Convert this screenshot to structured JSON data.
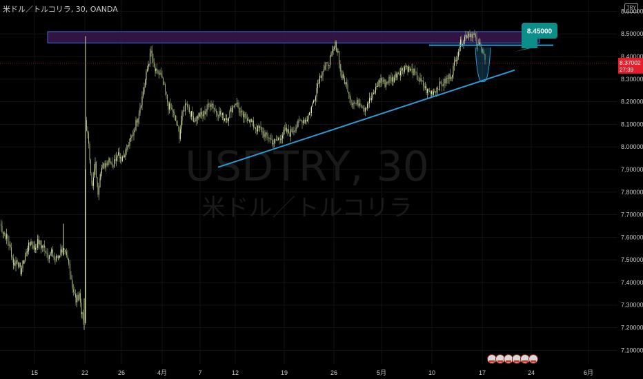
{
  "header": {
    "title": "米ドル／トルコリラ, 30, OANDA"
  },
  "currency_badge": "TRY",
  "watermark": {
    "symbol": "USDTRY, 30",
    "name": "米ドル／トルコリラ"
  },
  "colors": {
    "background": "#000000",
    "up_candle": "#d8e6a8",
    "down_candle": "#a3b878",
    "trendline": "#2a9bd6",
    "zone_fill": "#3a1650",
    "zone_border": "#3a6fd8",
    "current_price_bg": "#e21f2a",
    "callout_bg": "#0c8e8a"
  },
  "current_price": {
    "value": "8.37002",
    "countdown": "27:39"
  },
  "callout": {
    "text": "8.45000"
  },
  "chart_data": {
    "type": "candlestick",
    "title": "",
    "y_ticks": [
      "8.60000",
      "8.50000",
      "8.40000",
      "8.30000",
      "8.20000",
      "8.10000",
      "8.00000",
      "7.90000",
      "7.80000",
      "7.70000",
      "7.60000",
      "7.50000",
      "7.40000",
      "7.30000",
      "7.20000",
      "7.10000"
    ],
    "ylim": [
      7.04,
      8.65
    ],
    "x_ticks": [
      "15",
      "22",
      "26",
      "4月",
      "7",
      "12",
      "19",
      "26",
      "5月",
      "10",
      "17",
      "24",
      "6月"
    ],
    "series": [
      {
        "x": 0,
        "y": 7.66
      },
      {
        "x": 5,
        "y": 7.62
      },
      {
        "x": 10,
        "y": 7.6
      },
      {
        "x": 15,
        "y": 7.55
      },
      {
        "x": 20,
        "y": 7.48
      },
      {
        "x": 25,
        "y": 7.5
      },
      {
        "x": 30,
        "y": 7.45
      },
      {
        "x": 35,
        "y": 7.5
      },
      {
        "x": 40,
        "y": 7.55
      },
      {
        "x": 45,
        "y": 7.58
      },
      {
        "x": 50,
        "y": 7.55
      },
      {
        "x": 55,
        "y": 7.58
      },
      {
        "x": 60,
        "y": 7.56
      },
      {
        "x": 65,
        "y": 7.55
      },
      {
        "x": 70,
        "y": 7.52
      },
      {
        "x": 75,
        "y": 7.53
      },
      {
        "x": 80,
        "y": 7.5
      },
      {
        "x": 85,
        "y": 7.52
      },
      {
        "x": 90,
        "y": 7.55
      },
      {
        "x": 95,
        "y": 7.52
      },
      {
        "x": 100,
        "y": 7.48
      },
      {
        "x": 105,
        "y": 7.38
      },
      {
        "x": 110,
        "y": 7.32
      },
      {
        "x": 115,
        "y": 7.35
      },
      {
        "x": 119,
        "y": 7.25
      },
      {
        "x": 122,
        "y": 7.22
      },
      {
        "x": 124,
        "y": 8.12
      },
      {
        "x": 127,
        "y": 8.05
      },
      {
        "x": 130,
        "y": 7.95
      },
      {
        "x": 134,
        "y": 7.82
      },
      {
        "x": 138,
        "y": 7.92
      },
      {
        "x": 142,
        "y": 7.8
      },
      {
        "x": 146,
        "y": 7.9
      },
      {
        "x": 152,
        "y": 7.92
      },
      {
        "x": 158,
        "y": 7.95
      },
      {
        "x": 164,
        "y": 7.92
      },
      {
        "x": 170,
        "y": 7.98
      },
      {
        "x": 176,
        "y": 7.95
      },
      {
        "x": 182,
        "y": 7.98
      },
      {
        "x": 188,
        "y": 8.02
      },
      {
        "x": 194,
        "y": 8.07
      },
      {
        "x": 200,
        "y": 8.14
      },
      {
        "x": 206,
        "y": 8.22
      },
      {
        "x": 212,
        "y": 8.32
      },
      {
        "x": 216,
        "y": 8.38
      },
      {
        "x": 219,
        "y": 8.42
      },
      {
        "x": 222,
        "y": 8.36
      },
      {
        "x": 226,
        "y": 8.33
      },
      {
        "x": 232,
        "y": 8.32
      },
      {
        "x": 238,
        "y": 8.26
      },
      {
        "x": 244,
        "y": 8.18
      },
      {
        "x": 250,
        "y": 8.16
      },
      {
        "x": 256,
        "y": 8.1
      },
      {
        "x": 260,
        "y": 8.05
      },
      {
        "x": 264,
        "y": 8.14
      },
      {
        "x": 270,
        "y": 8.2
      },
      {
        "x": 276,
        "y": 8.15
      },
      {
        "x": 282,
        "y": 8.12
      },
      {
        "x": 288,
        "y": 8.14
      },
      {
        "x": 294,
        "y": 8.14
      },
      {
        "x": 300,
        "y": 8.17
      },
      {
        "x": 306,
        "y": 8.2
      },
      {
        "x": 312,
        "y": 8.16
      },
      {
        "x": 318,
        "y": 8.15
      },
      {
        "x": 324,
        "y": 8.13
      },
      {
        "x": 330,
        "y": 8.13
      },
      {
        "x": 336,
        "y": 8.17
      },
      {
        "x": 342,
        "y": 8.2
      },
      {
        "x": 348,
        "y": 8.15
      },
      {
        "x": 354,
        "y": 8.13
      },
      {
        "x": 360,
        "y": 8.13
      },
      {
        "x": 366,
        "y": 8.1
      },
      {
        "x": 372,
        "y": 8.08
      },
      {
        "x": 378,
        "y": 8.08
      },
      {
        "x": 384,
        "y": 8.05
      },
      {
        "x": 390,
        "y": 8.04
      },
      {
        "x": 396,
        "y": 8.02
      },
      {
        "x": 402,
        "y": 8.03
      },
      {
        "x": 408,
        "y": 8.05
      },
      {
        "x": 414,
        "y": 8.07
      },
      {
        "x": 420,
        "y": 8.06
      },
      {
        "x": 426,
        "y": 8.08
      },
      {
        "x": 432,
        "y": 8.1
      },
      {
        "x": 438,
        "y": 8.12
      },
      {
        "x": 444,
        "y": 8.12
      },
      {
        "x": 450,
        "y": 8.16
      },
      {
        "x": 456,
        "y": 8.22
      },
      {
        "x": 462,
        "y": 8.3
      },
      {
        "x": 468,
        "y": 8.34
      },
      {
        "x": 474,
        "y": 8.36
      },
      {
        "x": 480,
        "y": 8.4
      },
      {
        "x": 486,
        "y": 8.45
      },
      {
        "x": 490,
        "y": 8.42
      },
      {
        "x": 494,
        "y": 8.32
      },
      {
        "x": 498,
        "y": 8.3
      },
      {
        "x": 504,
        "y": 8.26
      },
      {
        "x": 510,
        "y": 8.2
      },
      {
        "x": 516,
        "y": 8.19
      },
      {
        "x": 522,
        "y": 8.2
      },
      {
        "x": 528,
        "y": 8.17
      },
      {
        "x": 534,
        "y": 8.2
      },
      {
        "x": 540,
        "y": 8.22
      },
      {
        "x": 546,
        "y": 8.27
      },
      {
        "x": 552,
        "y": 8.3
      },
      {
        "x": 558,
        "y": 8.28
      },
      {
        "x": 564,
        "y": 8.3
      },
      {
        "x": 570,
        "y": 8.3
      },
      {
        "x": 576,
        "y": 8.33
      },
      {
        "x": 582,
        "y": 8.34
      },
      {
        "x": 588,
        "y": 8.36
      },
      {
        "x": 594,
        "y": 8.34
      },
      {
        "x": 600,
        "y": 8.33
      },
      {
        "x": 606,
        "y": 8.3
      },
      {
        "x": 612,
        "y": 8.28
      },
      {
        "x": 618,
        "y": 8.25
      },
      {
        "x": 624,
        "y": 8.24
      },
      {
        "x": 630,
        "y": 8.25
      },
      {
        "x": 636,
        "y": 8.27
      },
      {
        "x": 642,
        "y": 8.28
      },
      {
        "x": 648,
        "y": 8.3
      },
      {
        "x": 654,
        "y": 8.32
      },
      {
        "x": 660,
        "y": 8.38
      },
      {
        "x": 666,
        "y": 8.45
      },
      {
        "x": 672,
        "y": 8.48
      },
      {
        "x": 678,
        "y": 8.5
      },
      {
        "x": 684,
        "y": 8.5
      },
      {
        "x": 688,
        "y": 8.49
      },
      {
        "x": 692,
        "y": 8.44
      },
      {
        "x": 696,
        "y": 8.46
      },
      {
        "x": 700,
        "y": 8.42
      },
      {
        "x": 704,
        "y": 8.37
      }
    ],
    "resistance_zone": {
      "y_top": 8.51,
      "y_bottom": 8.46,
      "x_start": 69,
      "x_end": 782
    },
    "horizontal_line": {
      "y": 8.45,
      "x_start": 622,
      "x_end": 802
    },
    "trendline": {
      "x1": 316,
      "y1": 7.91,
      "x2": 746,
      "y2": 8.34
    },
    "projection": {
      "x_center": 700,
      "y_top": 8.44,
      "y_bottom": 8.29
    }
  }
}
